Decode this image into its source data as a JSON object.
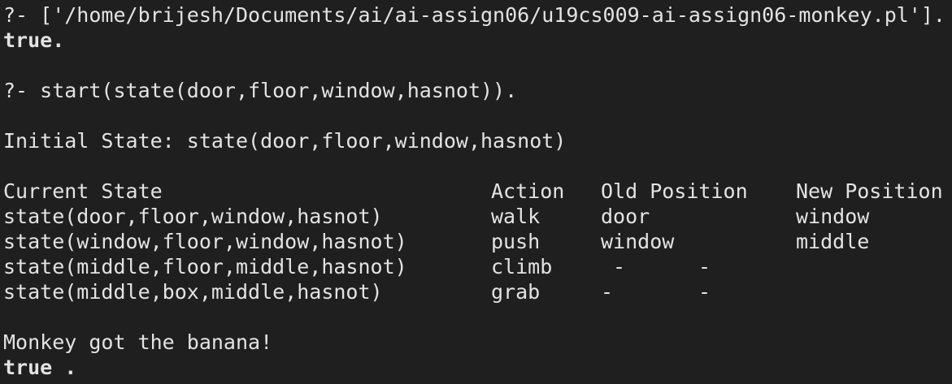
{
  "terminal": {
    "consult_line": "?- ['/home/brijesh/Documents/ai/ai-assign06/u19cs009-ai-assign06-monkey.pl'].",
    "true_1": "true.",
    "query_line": "?- start(state(door,floor,window,hasnot)).",
    "initial_state": "Initial State: state(door,floor,window,hasnot)",
    "table": {
      "headers": [
        "Current State",
        "Action",
        "Old Position",
        "New Position"
      ],
      "rows": [
        [
          "state(door,floor,window,hasnot)",
          "walk",
          "door",
          "window"
        ],
        [
          "state(window,floor,window,hasnot)",
          "push",
          "window",
          "middle"
        ],
        [
          "state(middle,floor,middle,hasnot)",
          "climb",
          " -",
          "-"
        ],
        [
          "state(middle,box,middle,hasnot)",
          "grab",
          "-",
          "-"
        ]
      ]
    },
    "result": "Monkey got the banana!",
    "true_2": "true ."
  },
  "colors": {
    "background": "#1f1f1f",
    "foreground": "#e3e3e3"
  }
}
